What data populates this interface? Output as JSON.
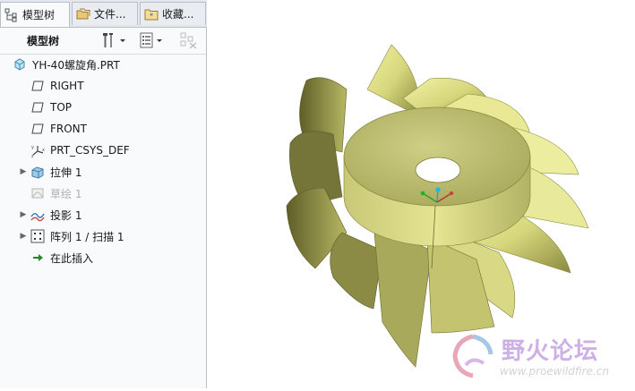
{
  "tabs": [
    {
      "label": "模型树",
      "icon": "model-tree-icon"
    },
    {
      "label": "文件...",
      "icon": "folder-icon"
    },
    {
      "label": "收藏...",
      "icon": "favorites-icon"
    }
  ],
  "toolbar": {
    "title": "模型树",
    "settings_icon": "tools-icon",
    "show_icon": "list-icon",
    "filter_icon": "filter-icon"
  },
  "tree": {
    "root": {
      "label": "YH-40螺旋角.PRT",
      "icon": "part-icon"
    },
    "items": [
      {
        "label": "RIGHT",
        "icon": "datum-plane-icon",
        "expandable": false,
        "disabled": false
      },
      {
        "label": "TOP",
        "icon": "datum-plane-icon",
        "expandable": false,
        "disabled": false
      },
      {
        "label": "FRONT",
        "icon": "datum-plane-icon",
        "expandable": false,
        "disabled": false
      },
      {
        "label": "PRT_CSYS_DEF",
        "icon": "coordinate-system-icon",
        "expandable": false,
        "disabled": false
      },
      {
        "label": "拉伸 1",
        "icon": "extrude-icon",
        "expandable": true,
        "disabled": false
      },
      {
        "label": "草绘 1",
        "icon": "sketch-icon",
        "expandable": false,
        "disabled": true
      },
      {
        "label": "投影 1",
        "icon": "projection-icon",
        "expandable": true,
        "disabled": false
      },
      {
        "label": "阵列 1 / 扫描 1",
        "icon": "pattern-icon",
        "expandable": true,
        "disabled": false
      },
      {
        "label": "在此插入",
        "icon": "insert-here-arrow-icon",
        "expandable": false,
        "disabled": false
      }
    ]
  },
  "watermark": {
    "title": "野火论坛",
    "url": "www.proewildfire.cn"
  },
  "colors": {
    "model": "#d8d87a",
    "model_dark": "#7f7f3a",
    "model_light": "#f2f2a0",
    "watermark_text": "#c9a8e0",
    "panel_bg": "#f9fafb"
  }
}
